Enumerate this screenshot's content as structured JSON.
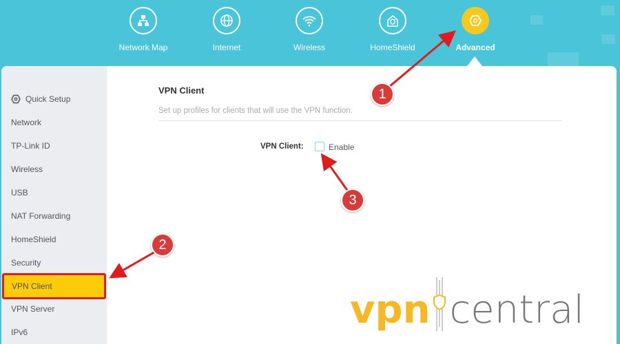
{
  "top_nav": {
    "items": [
      {
        "label": "Network Map",
        "icon": "network-map-icon",
        "active": false
      },
      {
        "label": "Internet",
        "icon": "globe-icon",
        "active": false
      },
      {
        "label": "Wireless",
        "icon": "wifi-icon",
        "active": false
      },
      {
        "label": "HomeShield",
        "icon": "homeshield-icon",
        "active": false
      },
      {
        "label": "Advanced",
        "icon": "gear-icon",
        "active": true
      }
    ],
    "accent_color": "#f8c81c",
    "bar_color": "#4ac4d8"
  },
  "sidebar": {
    "items": [
      {
        "label": "Quick Setup",
        "icon": "gear-icon"
      },
      {
        "label": "Network"
      },
      {
        "label": "TP-Link ID"
      },
      {
        "label": "Wireless"
      },
      {
        "label": "USB"
      },
      {
        "label": "NAT Forwarding"
      },
      {
        "label": "HomeShield"
      },
      {
        "label": "Security"
      },
      {
        "label": "VPN Client",
        "active": true
      },
      {
        "label": "VPN Server"
      },
      {
        "label": "IPv6"
      }
    ],
    "active_color": "#fccb0a"
  },
  "content": {
    "title": "VPN Client",
    "description": "Set up profiles for clients that will use the VPN function.",
    "field_label": "VPN Client:",
    "checkbox_label": "Enable",
    "checkbox_checked": false
  },
  "annotations": {
    "badges": [
      "1",
      "2",
      "3"
    ],
    "color": "#d93a3a"
  },
  "watermark": {
    "part1": "vpn",
    "part2": "central"
  }
}
